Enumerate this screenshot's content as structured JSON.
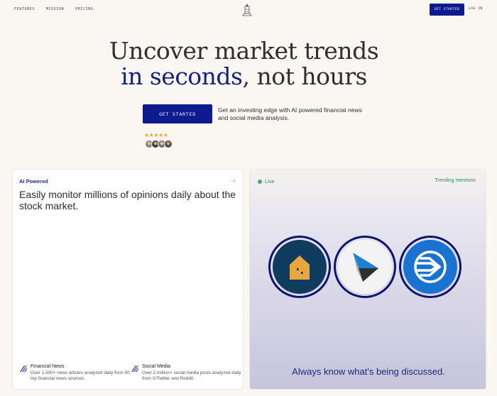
{
  "nav": {
    "links": [
      "FEATURES",
      "MISSION",
      "PRICING"
    ],
    "cta_label": "GET STARTED",
    "login_label": "LOG IN"
  },
  "hero": {
    "title_line1": "Uncover market trends",
    "title_accent": "in seconds",
    "title_rest": ", not hours",
    "cta_label": "GET STARTED",
    "subtitle": "Get an investing edge with AI powered financial news and social media analysis.",
    "stars": "★★★★★",
    "rating": 5
  },
  "left_card": {
    "tag": "AI Powered",
    "arrow": "→",
    "headline": "Easily monitor millions of opinions daily about the stock market.",
    "features": [
      {
        "title": "Financial News",
        "desc": "Over 1,500+ news articles analyzed daily from 50 top financial news sources.",
        "icon": "stripes-icon"
      },
      {
        "title": "Social Media",
        "desc": "Over 2 million+ social media posts analyzed daily from X/Twitter and Reddit.",
        "icon": "stripes-icon"
      }
    ]
  },
  "right_card": {
    "live_label": "Live",
    "trending_label": "Trending mentions",
    "logos": [
      "house-logo-icon",
      "play-logo-icon",
      "lines-logo-icon"
    ],
    "tagline": "Always know what's being discussed."
  },
  "colors": {
    "brand": "#0d1b8e",
    "accent_text": "#14237e",
    "background": "#faf7f2",
    "live": "#3fae7a",
    "stars": "#e7a828"
  }
}
